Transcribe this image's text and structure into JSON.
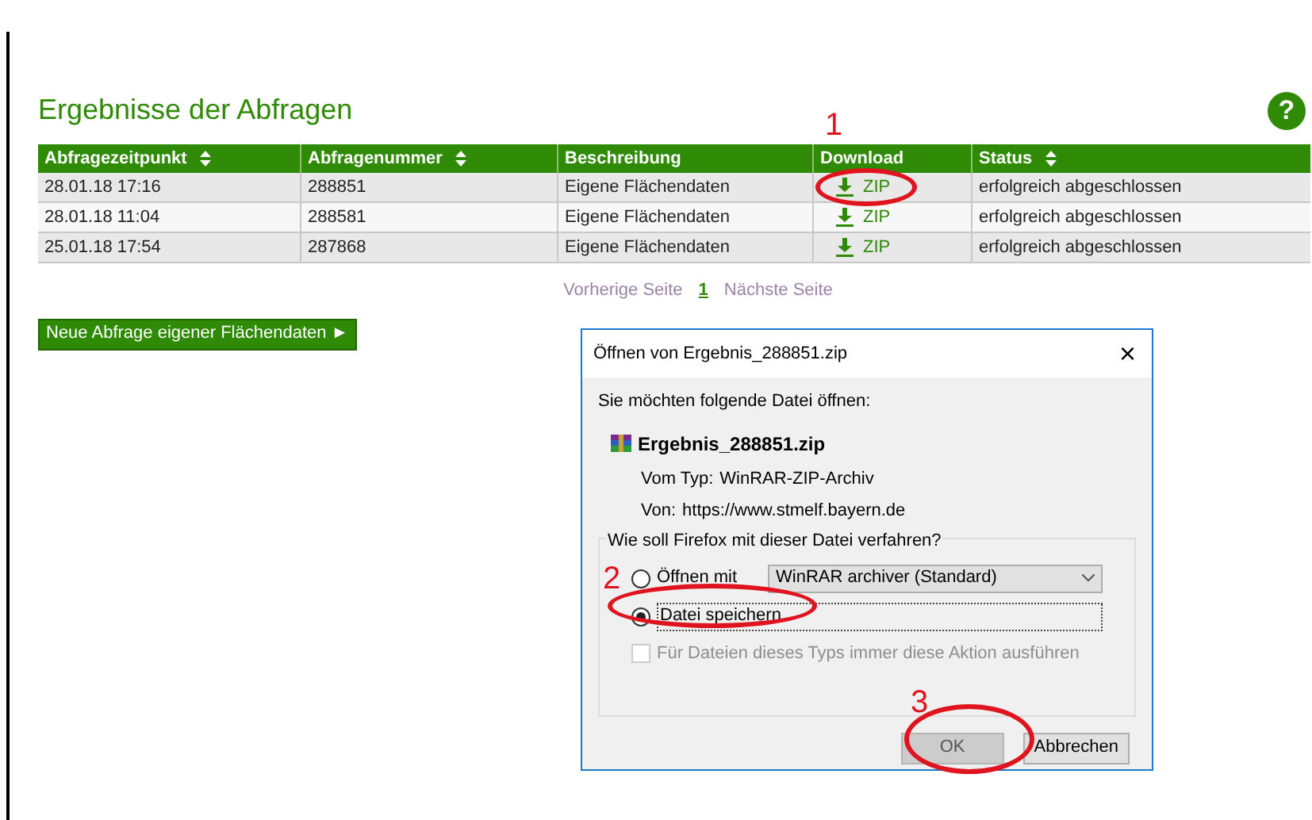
{
  "page": {
    "title": "Ergebnisse der Abfragen",
    "help": "?"
  },
  "table": {
    "columns": [
      {
        "label": "Abfragezeitpunkt",
        "sortable": true
      },
      {
        "label": "Abfragenummer",
        "sortable": true
      },
      {
        "label": "Beschreibung",
        "sortable": false
      },
      {
        "label": "Download",
        "sortable": false
      },
      {
        "label": "Status",
        "sortable": true
      }
    ],
    "rows": [
      {
        "time": "28.01.18 17:16",
        "number": "288851",
        "description": "Eigene Flächendaten",
        "download": "ZIP",
        "status": "erfolgreich abgeschlossen"
      },
      {
        "time": "28.01.18 11:04",
        "number": "288581",
        "description": "Eigene Flächendaten",
        "download": "ZIP",
        "status": "erfolgreich abgeschlossen"
      },
      {
        "time": "25.01.18 17:54",
        "number": "287868",
        "description": "Eigene Flächendaten",
        "download": "ZIP",
        "status": "erfolgreich abgeschlossen"
      }
    ]
  },
  "pagination": {
    "previous": "Vorherige Seite",
    "pages": [
      {
        "label": "1",
        "selected": true
      }
    ],
    "next": "Nächste Seite"
  },
  "new_query_button": "Neue Abfrage eigener Flächendaten ►",
  "dialog": {
    "title": "Öffnen von Ergebnis_288851.zip",
    "close": "×",
    "intro": "Sie möchten folgende Datei öffnen:",
    "file": "Ergebnis_288851.zip",
    "type_label": "Vom Typ:",
    "type": "WinRAR-ZIP-Archiv",
    "from_label": "Von:",
    "from": "https://www.stmelf.bayern.de",
    "group_title": "Wie soll Firefox mit dieser Datei verfahren?",
    "options": [
      {
        "label": "Öffnen mit",
        "selected": false,
        "kind": "select",
        "value": "WinRAR archiver (Standard)"
      },
      {
        "label": "Datei speichern",
        "selected": true,
        "kind": "plain"
      }
    ],
    "remember": {
      "label": "Für Dateien dieses Typs immer diese Aktion ausführen",
      "checked": false,
      "disabled": true
    },
    "buttons": [
      {
        "label": "OK",
        "default": true
      },
      {
        "label": "Abbrechen",
        "default": false
      }
    ]
  },
  "annotations": [
    {
      "label": "1"
    },
    {
      "label": "2"
    },
    {
      "label": "3"
    }
  ]
}
